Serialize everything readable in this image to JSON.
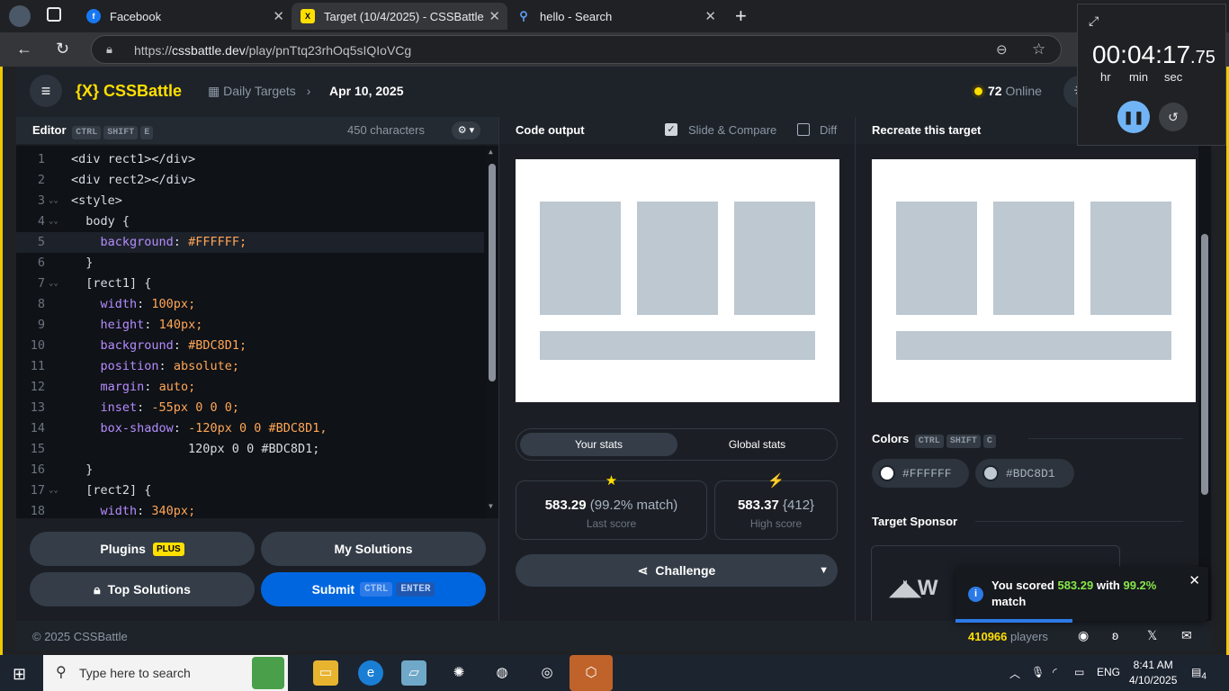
{
  "browser": {
    "tabs": [
      {
        "title": "Facebook",
        "icon": "facebook-icon",
        "color": "#1877f2"
      },
      {
        "title": "Target (10/4/2025) - CSSBattle",
        "icon": "cssbattle-icon",
        "color": "#ffdf00"
      },
      {
        "title": "hello - Search",
        "icon": "search-icon",
        "color": "#5e9cf5"
      }
    ],
    "url_prefix": "https://",
    "url_domain": "cssbattle.dev",
    "url_path": "/play/pnTtq23rhOq5sIQIoVCg"
  },
  "app": {
    "logo": "{X} CSSBattle",
    "breadcrumb": {
      "section": "Daily Targets",
      "date": "Apr 10, 2025"
    },
    "online_count": "72",
    "online_label": "Online",
    "editor": {
      "title": "Editor",
      "shortcut": [
        "CTRL",
        "SHIFT",
        "E"
      ],
      "characters": "450 characters",
      "lines": [
        "<div rect1></div>",
        "<div rect2></div>",
        "<style>",
        "  body {",
        "    background: #FFFFFF;",
        "  }",
        "  [rect1] {",
        "    width: 100px;",
        "    height: 140px;",
        "    background: #BDC8D1;",
        "    position: absolute;",
        "    margin: auto;",
        "    inset: -55px 0 0 0;",
        "    box-shadow: -120px 0 0 #BDC8D1,",
        "                120px 0 0 #BDC8D1;",
        "  }",
        "  [rect2] {",
        "    width: 340px;"
      ]
    },
    "buttons": {
      "plugins": "Plugins",
      "plugins_badge": "PLUS",
      "my_solutions": "My Solutions",
      "top_solutions": "Top Solutions",
      "submit": "Submit",
      "submit_keys": [
        "CTRL",
        "ENTER"
      ]
    },
    "output": {
      "title": "Code output",
      "slide_compare": "Slide & Compare",
      "slide_compare_checked": true,
      "diff": "Diff",
      "diff_checked": false
    },
    "stats": {
      "tab_your": "Your stats",
      "tab_global": "Global stats",
      "last_score": "583.29",
      "last_match": "(99.2% match)",
      "last_label": "Last score",
      "high_score": "583.37",
      "high_extra": "{412}",
      "high_label": "High score",
      "challenge": "Challenge"
    },
    "target": {
      "title": "Recreate this target",
      "colors_title": "Colors",
      "colors_shortcut": [
        "CTRL",
        "SHIFT",
        "C"
      ],
      "colors": [
        "#FFFFFF",
        "#BDC8D1"
      ],
      "sponsor_title": "Target Sponsor"
    },
    "footer": {
      "copyright": "© 2025 CSSBattle",
      "players_count": "410966",
      "players_label": "players"
    },
    "toast": {
      "prefix": "You scored",
      "score": "583.29",
      "mid": "with",
      "pct": "99.2%",
      "suffix": "match"
    }
  },
  "timer": {
    "hours": "00",
    "minutes": "04",
    "seconds": "17",
    "fraction": ".75",
    "label_hr": "hr",
    "label_min": "min",
    "label_sec": "sec"
  },
  "taskbar": {
    "search_placeholder": "Type here to search",
    "language": "ENG",
    "time": "8:41 AM",
    "date": "4/10/2025",
    "notifications": "4"
  }
}
